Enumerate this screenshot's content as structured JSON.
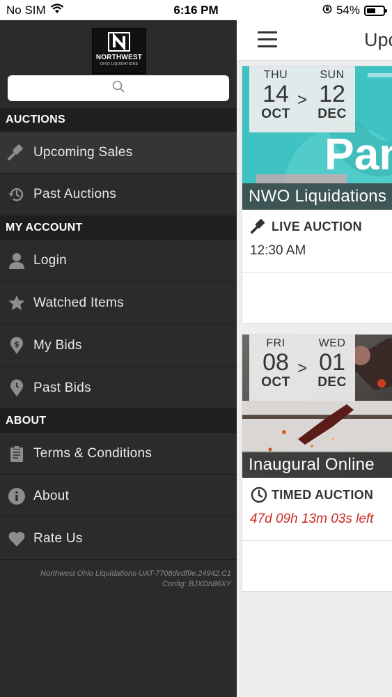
{
  "status_bar": {
    "carrier": "No SIM",
    "time": "6:16 PM",
    "battery_percent": "54%",
    "battery_level": 0.54
  },
  "drawer": {
    "logo": {
      "line1": "NORTHWEST",
      "line2": "OHIO LIQUIDATIONS"
    },
    "search": {
      "placeholder": ""
    },
    "sections": [
      {
        "title": "AUCTIONS",
        "items": [
          {
            "label": "Upcoming Sales",
            "icon": "gavel-icon",
            "active": true
          },
          {
            "label": "Past Auctions",
            "icon": "history-icon",
            "active": false
          }
        ]
      },
      {
        "title": "MY ACCOUNT",
        "items": [
          {
            "label": "Login",
            "icon": "person-icon",
            "active": false
          },
          {
            "label": "Watched Items",
            "icon": "star-icon",
            "active": false
          },
          {
            "label": "My Bids",
            "icon": "dollar-pin-icon",
            "active": false
          },
          {
            "label": "Past Bids",
            "icon": "clock-pin-icon",
            "active": false
          }
        ]
      },
      {
        "title": "ABOUT",
        "items": [
          {
            "label": "Terms & Conditions",
            "icon": "clipboard-icon",
            "active": false
          },
          {
            "label": "About",
            "icon": "info-icon",
            "active": false
          },
          {
            "label": "Rate Us",
            "icon": "heart-icon",
            "active": false
          }
        ]
      }
    ],
    "footer": {
      "version": "Northwest Ohio Liquidations-UAT-7708dedf9e.24942.C1",
      "config": "Config: BJXDh86XY"
    }
  },
  "main": {
    "title": "Upcoming Sales",
    "cards": [
      {
        "start": {
          "dow": "THU",
          "day": "14",
          "mon": "OCT"
        },
        "end": {
          "dow": "SUN",
          "day": "12",
          "mon": "DEC"
        },
        "separator": ">",
        "title": "NWO Liquidations",
        "type": "LIVE AUCTION",
        "type_icon": "gavel-icon",
        "time": "12:30 AM"
      },
      {
        "start": {
          "dow": "FRI",
          "day": "08",
          "mon": "OCT"
        },
        "end": {
          "dow": "WED",
          "day": "01",
          "mon": "DEC"
        },
        "separator": ">",
        "title": "Inaugural Online",
        "type": "TIMED AUCTION",
        "type_icon": "clock-icon",
        "time": "47d 09h 13m 03s left"
      }
    ]
  },
  "colors": {
    "drawer_bg": "#2b2b2c",
    "section_bg": "#1f1f20",
    "countdown_red": "#cc2a24",
    "promo_teal": "#3fc2c2"
  }
}
